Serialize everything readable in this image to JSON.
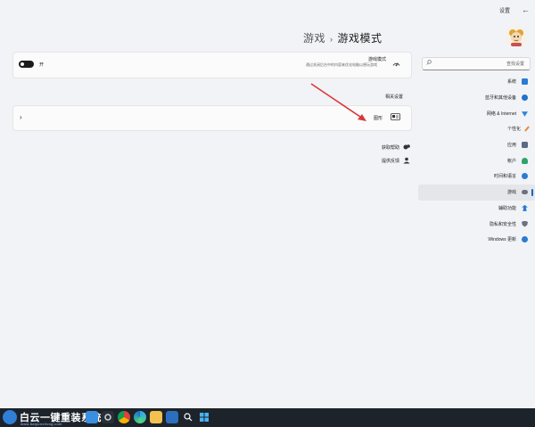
{
  "app": {
    "title": "设置"
  },
  "search": {
    "placeholder": "查找设置"
  },
  "nav": {
    "items": [
      {
        "label": "系统",
        "icon": "monitor-icon",
        "color": "#2a7bd4",
        "active": false
      },
      {
        "label": "蓝牙和其他设备",
        "icon": "bluetooth-icon",
        "color": "#1f73c9",
        "active": false
      },
      {
        "label": "网络 & Internet",
        "icon": "wifi-icon",
        "color": "#2b86d9",
        "active": false
      },
      {
        "label": "个性化",
        "icon": "brush-icon",
        "color": "#e08a3c",
        "active": false
      },
      {
        "label": "应用",
        "icon": "apps-icon",
        "color": "#5b6b82",
        "active": false
      },
      {
        "label": "帐户",
        "icon": "person-icon",
        "color": "#2fa36b",
        "active": false
      },
      {
        "label": "时间和语言",
        "icon": "globe-clock-icon",
        "color": "#2a7bd4",
        "active": false
      },
      {
        "label": "游戏",
        "icon": "gamepad-icon",
        "color": "#6a7280",
        "active": true
      },
      {
        "label": "辅助功能",
        "icon": "accessibility-icon",
        "color": "#2a7bd4",
        "active": false
      },
      {
        "label": "隐私和安全性",
        "icon": "shield-icon",
        "color": "#6a7280",
        "active": false
      },
      {
        "label": "Windows 更新",
        "icon": "update-icon",
        "color": "#2a7bd4",
        "active": false
      }
    ]
  },
  "breadcrumb": {
    "parent": "游戏",
    "separator": "›",
    "current": "游戏模式"
  },
  "game_mode": {
    "title": "游戏模式",
    "description": "通过关闭后台中的内容来优化电脑以便玩游戏",
    "toggle_label": "开",
    "toggle_on": true
  },
  "related": {
    "heading": "相关设置",
    "graphics_label": "图形"
  },
  "links": [
    {
      "label": "获取帮助",
      "icon": "help-icon"
    },
    {
      "label": "提供反馈",
      "icon": "feedback-icon"
    }
  ],
  "watermark": {
    "text": "白云一键重装系统",
    "sub": "www.baiyunxitong.com"
  },
  "colors": {
    "accent": "#0067c0",
    "arrow": "#d9383a",
    "taskbar": "#1d232b"
  }
}
